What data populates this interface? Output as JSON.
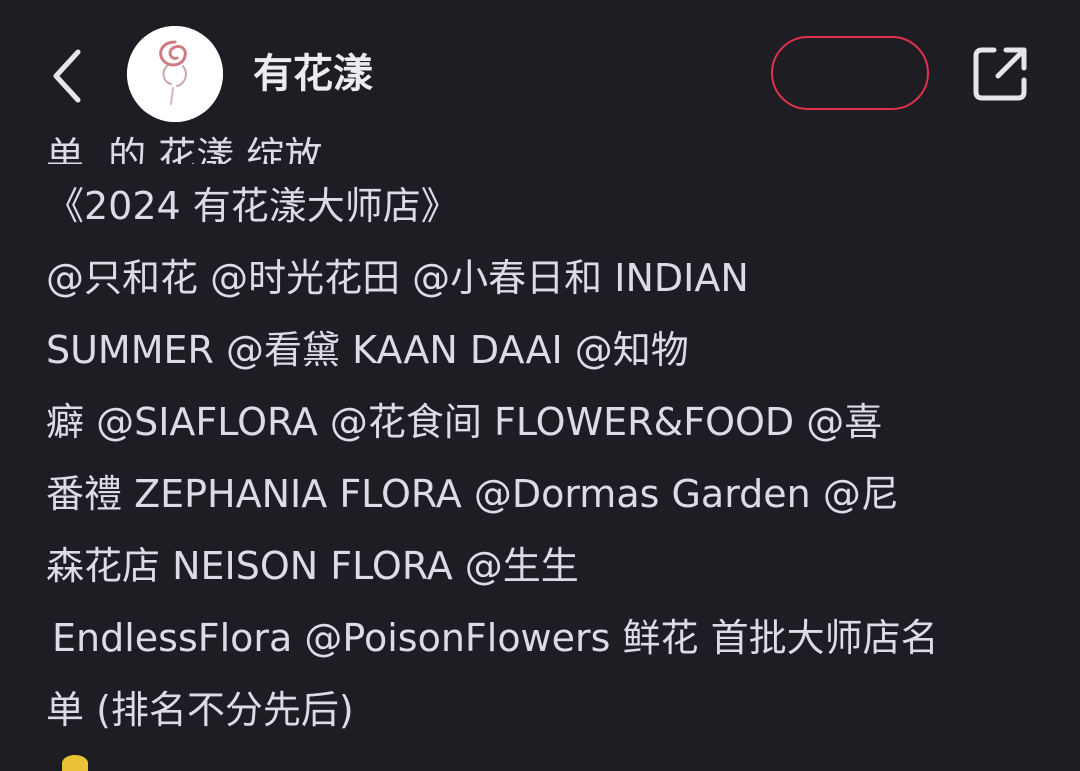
{
  "header": {
    "back_icon": "chevron-left-icon",
    "account_name": "有花漾",
    "share_icon": "share-external-icon"
  },
  "post": {
    "lines": [
      "单,             的  花漾  绽放",
      "《2024 有花漾大师店》",
      "@只和花  @时光花田  @小春日和 INDIAN",
      "SUMMER  @看黛 KAAN DAAI  @知物",
      "癖  @SIAFLORA  @花食间 FLOWER&FOOD  @喜",
      "番禮 ZEPHANIA FLORA   @Dormas Garden  @尼",
      "森花店 NEISON FLORA   @生生",
      "EndlessFlora  @PoisonFlowers 鲜花 首批大师店名",
      "单 (排名不分先后)"
    ]
  },
  "colors": {
    "background": "#1e1d23",
    "text": "#dcdde4",
    "follow_border": "#e1314d"
  }
}
